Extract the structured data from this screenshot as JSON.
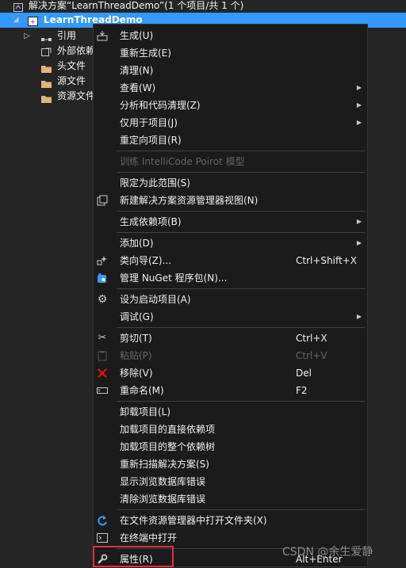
{
  "solution_explorer": {
    "solution_label": "解决方案“LearnThreadDemo”(1 个项目/共 1 个)",
    "project_label": "LearnThreadDemo",
    "items": [
      {
        "label": "引用"
      },
      {
        "label": "外部依赖项"
      },
      {
        "label": "头文件"
      },
      {
        "label": "源文件"
      },
      {
        "label": "资源文件"
      }
    ]
  },
  "context_menu": {
    "build": "生成(U)",
    "rebuild": "重新生成(E)",
    "clean": "清理(N)",
    "view": "查看(W)",
    "analyze": "分析和代码清理(Z)",
    "project_only": "仅用于项目(J)",
    "retarget": "重定向项目(R)",
    "train_intellicode": "训练 IntelliCode Poirot 模型",
    "scope_to_this": "限定为此范围(S)",
    "new_solution_view": "新建解决方案资源管理器视图(N)",
    "build_dependencies": "生成依赖项(B)",
    "add": "添加(D)",
    "class_wizard": "类向导(Z)...",
    "class_wizard_shortcut": "Ctrl+Shift+X",
    "manage_nuget": "管理 NuGet 程序包(N)...",
    "set_startup": "设为启动项目(A)",
    "debug": "调试(G)",
    "cut": "剪切(T)",
    "cut_shortcut": "Ctrl+X",
    "paste": "粘贴(P)",
    "paste_shortcut": "Ctrl+V",
    "remove": "移除(V)",
    "remove_shortcut": "Del",
    "rename": "重命名(M)",
    "rename_shortcut": "F2",
    "unload": "卸载项目(L)",
    "load_direct_deps": "加载项目的直接依赖项",
    "load_dep_tree": "加载项目的整个依赖树",
    "rescan": "重新扫描解决方案(S)",
    "show_db_errors": "显示浏览数据库错误",
    "clear_db_errors": "清除浏览数据库错误",
    "open_in_explorer": "在文件资源管理器中打开文件夹(X)",
    "open_in_terminal": "在终端中打开",
    "properties": "属性(R)",
    "properties_shortcut": "Alt+Enter"
  },
  "watermark": "CSDN @余生爱静",
  "colors": {
    "selection": "#3399ff",
    "menu_bg": "#1b1b1c",
    "highlight_border": "#e0303a",
    "remove_icon": "#e51400"
  }
}
